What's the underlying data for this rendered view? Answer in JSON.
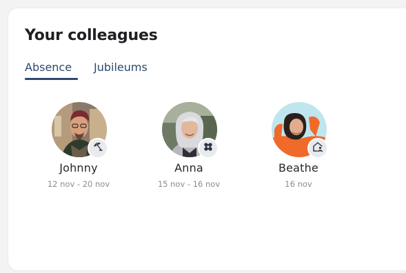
{
  "widget": {
    "title": "Your colleagues",
    "tabs": [
      {
        "label": "Absence",
        "active": true
      },
      {
        "label": "Jubileums",
        "active": false
      }
    ]
  },
  "colleagues": [
    {
      "name": "Johnny",
      "dates": "12 nov - 20 nov",
      "status_icon": "beach-umbrella-icon"
    },
    {
      "name": "Anna",
      "dates": "15 nov - 16 nov",
      "status_icon": "bandage-icon"
    },
    {
      "name": "Beathe",
      "dates": "16 nov",
      "status_icon": "home-office-icon"
    }
  ],
  "colors": {
    "accent": "#2c4a6d",
    "badge_bg": "#e8eaee",
    "muted_text": "#8a8a93"
  }
}
